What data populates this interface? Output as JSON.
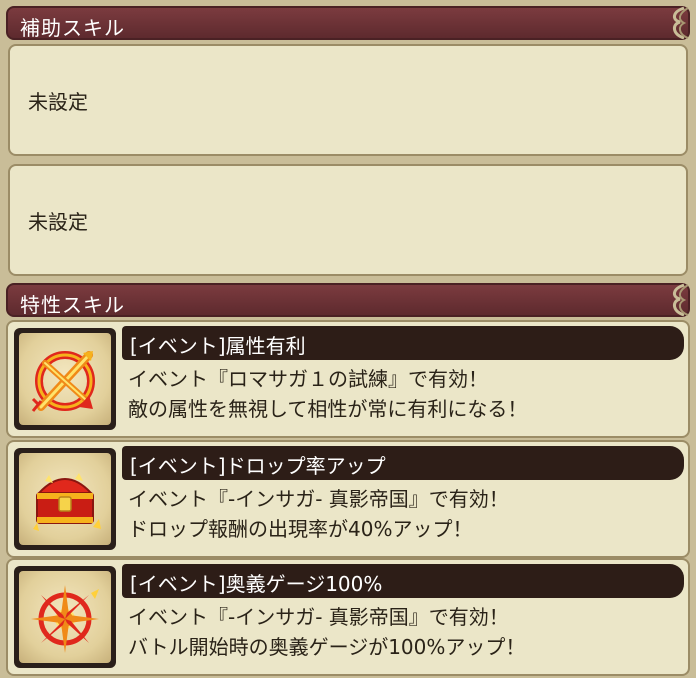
{
  "support_skills": {
    "header": "補助スキル",
    "slots": [
      {
        "text": "未設定"
      },
      {
        "text": "未設定"
      }
    ]
  },
  "trait_skills": {
    "header": "特性スキル",
    "items": [
      {
        "title": "[イベント]属性有利",
        "desc_line1": "イベント『ロマサガ１の試練』で有効！",
        "desc_line2": "敵の属性を無視して相性が常に有利になる！",
        "icon": "attribute-advantage-icon"
      },
      {
        "title": "[イベント]ドロップ率アップ",
        "desc_line1": "イベント『-インサガ- 真影帝国』で有効！",
        "desc_line2": "ドロップ報酬の出現率が40%アップ！",
        "icon": "treasure-chest-icon"
      },
      {
        "title": "[イベント]奥義ゲージ100%",
        "desc_line1": "イベント『-インサガ- 真影帝国』で有効！",
        "desc_line2": "バトル開始時の奥義ゲージが100%アップ！",
        "icon": "compass-star-icon"
      }
    ]
  },
  "colors": {
    "header_bg": "#6b3236",
    "panel_bg": "#ebe6c8",
    "title_bar_bg": "#2d1d17",
    "page_bg": "#c9bd98"
  }
}
